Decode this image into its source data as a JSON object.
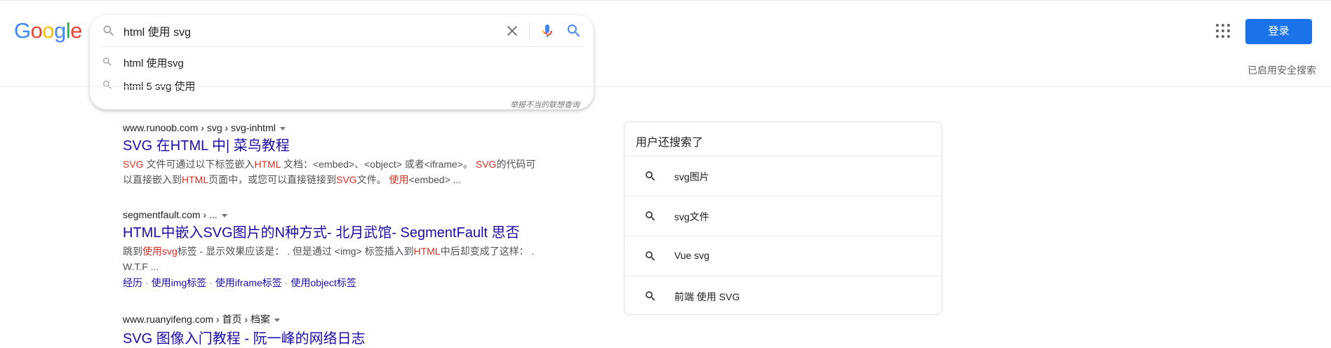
{
  "logo": {
    "letters": [
      "G",
      "o",
      "o",
      "g",
      "l",
      "e"
    ],
    "colors": [
      "#4285F4",
      "#EA4335",
      "#FBBC05",
      "#4285F4",
      "#34A853",
      "#EA4335"
    ]
  },
  "search": {
    "query": "html 使用 svg",
    "suggestions": [
      {
        "text": "html 使用svg"
      },
      {
        "text": "html 5 svg 使用"
      }
    ],
    "report_link": "举报不当的联想查询"
  },
  "header": {
    "login_label": "登录",
    "safesearch_label": "已启用安全搜索"
  },
  "results": [
    {
      "cite": "www.runoob.com › svg › svg-inhtml",
      "title": "SVG 在HTML 中| 菜鸟教程",
      "snippet_lines": [
        [
          {
            "t": "SVG",
            "hl": true
          },
          {
            "t": " 文件可通过以下标签嵌入"
          },
          {
            "t": "HTML",
            "hl": true
          },
          {
            "t": " 文档：<embed>、<object> 或者<iframe>。 "
          },
          {
            "t": "SVG",
            "hl": true
          },
          {
            "t": "的代码可"
          }
        ],
        [
          {
            "t": "以直接嵌入到"
          },
          {
            "t": "HTML",
            "hl": true
          },
          {
            "t": "页面中，或您可以直接链接到"
          },
          {
            "t": "SVG",
            "hl": true
          },
          {
            "t": "文件。 "
          },
          {
            "t": "使用",
            "hl": true
          },
          {
            "t": "<embed> ..."
          }
        ]
      ]
    },
    {
      "cite": "segmentfault.com › ...",
      "title": "HTML中嵌入SVG图片的N种方式- 北月武馆- SegmentFault 思否",
      "snippet_lines": [
        [
          {
            "t": "跳到"
          },
          {
            "t": "使用svg",
            "hl": true
          },
          {
            "t": "标签 - 显示效果应该是： . 但是通过 <img> 标签插入到"
          },
          {
            "t": "HTML",
            "hl": true
          },
          {
            "t": "中后却变成了这样： ."
          }
        ],
        [
          {
            "t": "W.T.F ..."
          }
        ]
      ],
      "sitelinks": [
        "经历",
        "使用img标签",
        "使用iframe标签",
        "使用object标签"
      ]
    },
    {
      "cite": "www.ruanyifeng.com › 首页 › 档案",
      "title": "SVG 图像入门教程 - 阮一峰的网络日志"
    }
  ],
  "related": {
    "title": "用户还搜索了",
    "items": [
      "svg图片",
      "svg文件",
      "Vue svg",
      "前端 使用 SVG"
    ]
  },
  "colors": {
    "link": "#1a0dab",
    "highlight": "#d93025",
    "button": "#1a73e8"
  }
}
